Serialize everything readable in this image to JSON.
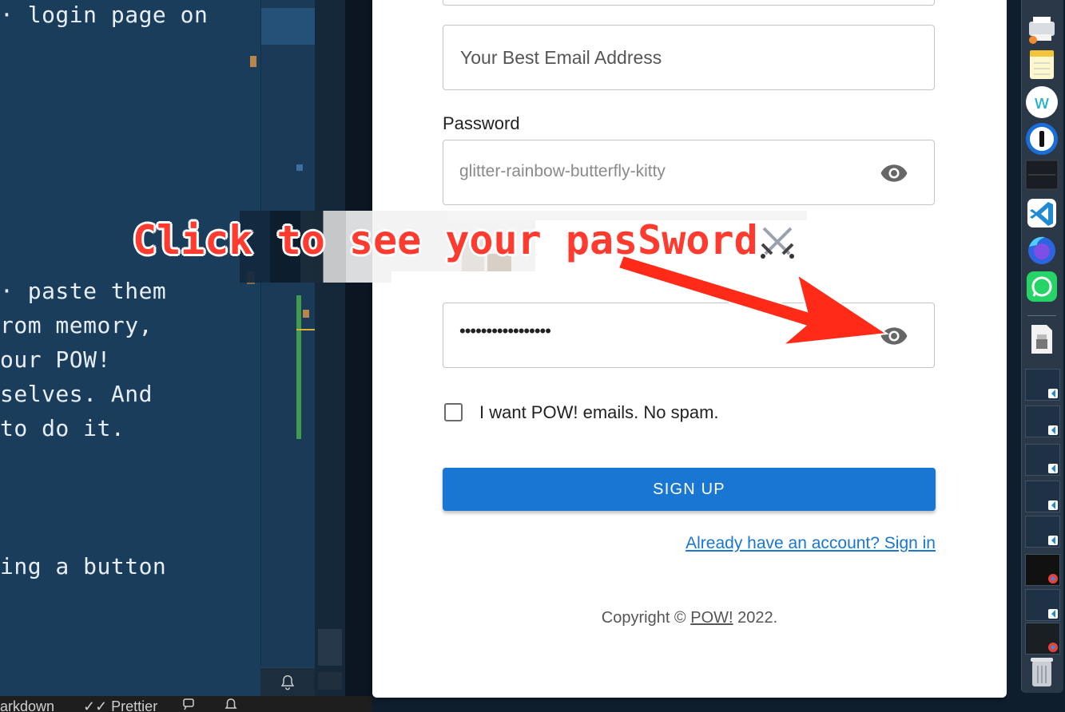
{
  "editor": {
    "lines": [
      "· login page on",
      "· paste them",
      "rom memory,",
      "our POW!",
      "selves. And",
      "to do it.",
      "ing a button"
    ]
  },
  "statusbar": {
    "markdown": "arkdown",
    "prettier": "✓✓ Prettier"
  },
  "form": {
    "email_placeholder": "Your Best Email Address",
    "password_label": "Password",
    "password_visible_value": "glitter-rainbow-butterfly-kitty",
    "password_masked_value": "•••••••••••••••••",
    "checkbox_label": "I want POW! emails. No spam.",
    "checkbox_checked": false,
    "signup_label": "SIGN UP",
    "signin_link": "Already have an account? Sign in",
    "copyright_prefix": "Copyright ©",
    "copyright_brand": "POW!",
    "copyright_year": "2022."
  },
  "annotation": {
    "text": "Click to see your pasSword",
    "color": "#ff3b2f"
  },
  "colors": {
    "primary": "#1976d2",
    "editor_bg": "#1b3d5c"
  },
  "dock": {
    "items": [
      "printer-icon",
      "notes-icon",
      "w-app-icon",
      "1password-icon",
      "screen-recorder-icon",
      "vscode-icon",
      "firefox-icon",
      "whatsapp-icon",
      "archive-icon",
      "vscode-window",
      "vscode-window",
      "vscode-window",
      "vscode-window",
      "vscode-window",
      "chrome-window",
      "vscode-window",
      "chrome-window",
      "trash-icon"
    ]
  }
}
